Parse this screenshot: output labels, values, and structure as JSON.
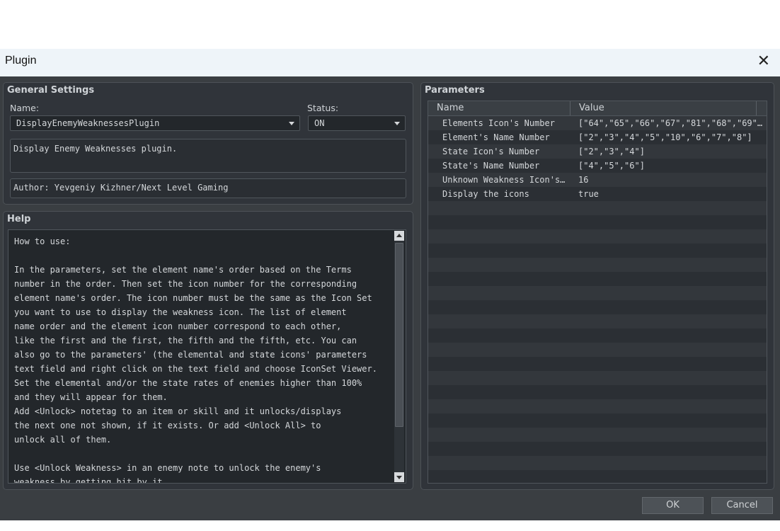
{
  "window": {
    "title": "Plugin"
  },
  "general": {
    "title": "General Settings",
    "name_label": "Name:",
    "status_label": "Status:",
    "name_value": "DisplayEnemyWeaknessesPlugin",
    "status_value": "ON",
    "description": "Display Enemy Weaknesses plugin.",
    "author": "Author: Yevgeniy Kizhner/Next Level Gaming"
  },
  "help": {
    "title": "Help",
    "text": "How to use:\n\nIn the parameters, set the element name's order based on the Terms\nnumber in the order. Then set the icon number for the corresponding\nelement name's order. The icon number must be the same as the Icon Set\nyou want to use to display the weakness icon. The list of element\nname order and the element icon number correspond to each other,\nlike the first and the first, the fifth and the fifth, etc. You can\nalso go to the parameters' (the elemental and state icons' parameters\ntext field and right click on the text field and choose IconSet Viewer.\nSet the elemental and/or the state rates of enemies higher than 100%\nand they will appear for them.\nAdd <Unlock> notetag to an item or skill and it unlocks/displays\nthe next one not shown, if it exists. Or add <Unlock All> to\nunlock all of them.\n\nUse <Unlock Weakness> in an enemy note to unlock the enemy's\nweakness by getting hit by it."
  },
  "parameters": {
    "title": "Parameters",
    "columns": [
      "Name",
      "Value"
    ],
    "rows": [
      {
        "name": "Elements Icon's Number",
        "value": "[\"64\",\"65\",\"66\",\"67\",\"81\",\"68\",\"69\"···"
      },
      {
        "name": "Element's Name Number",
        "value": "[\"2\",\"3\",\"4\",\"5\",\"10\",\"6\",\"7\",\"8\"]"
      },
      {
        "name": "State Icon's Number",
        "value": "[\"2\",\"3\",\"4\"]"
      },
      {
        "name": "State's Name Number",
        "value": "[\"4\",\"5\",\"6\"]"
      },
      {
        "name": "Unknown Weakness Icon's ···",
        "value": "16"
      },
      {
        "name": "Display the icons",
        "value": "true"
      }
    ]
  },
  "buttons": {
    "ok": "OK",
    "cancel": "Cancel"
  }
}
